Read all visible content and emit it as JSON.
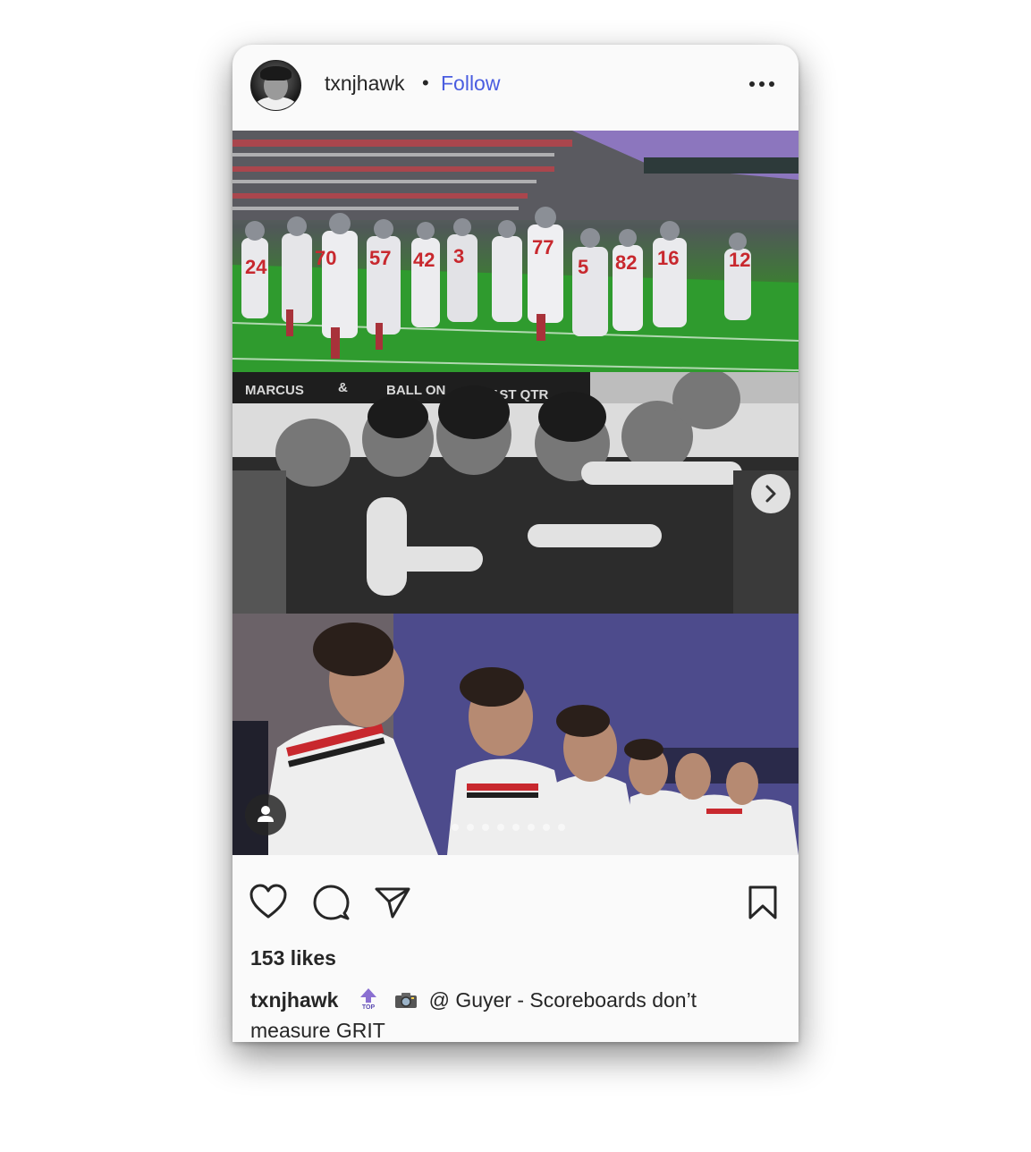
{
  "post": {
    "username": "txnjhawk",
    "separator": "•",
    "follow_label": "Follow",
    "likes": "153 likes",
    "caption_user": "txnjhawk",
    "caption_text": "@ Guyer - Scoreboards don’t measure GRIT",
    "emojis": [
      "top-arrow-icon",
      "camera-icon"
    ],
    "carousel_dots": 8
  },
  "media": {
    "panels": [
      {
        "name": "photo-team-running-onto-field"
      },
      {
        "name": "photo-team-huddle-bw"
      },
      {
        "name": "photo-players-sideline"
      }
    ],
    "scoreboard_text": [
      "MARCUS",
      "&",
      "BALL ON",
      "1ST QTR"
    ],
    "jersey_numbers": [
      "24",
      "70",
      "57",
      "42",
      "3",
      "77",
      "5",
      "82",
      "16",
      "12"
    ]
  },
  "colors": {
    "accent_follow": "#4a5de0",
    "text": "#262626",
    "card_bg": "#fafafa"
  }
}
